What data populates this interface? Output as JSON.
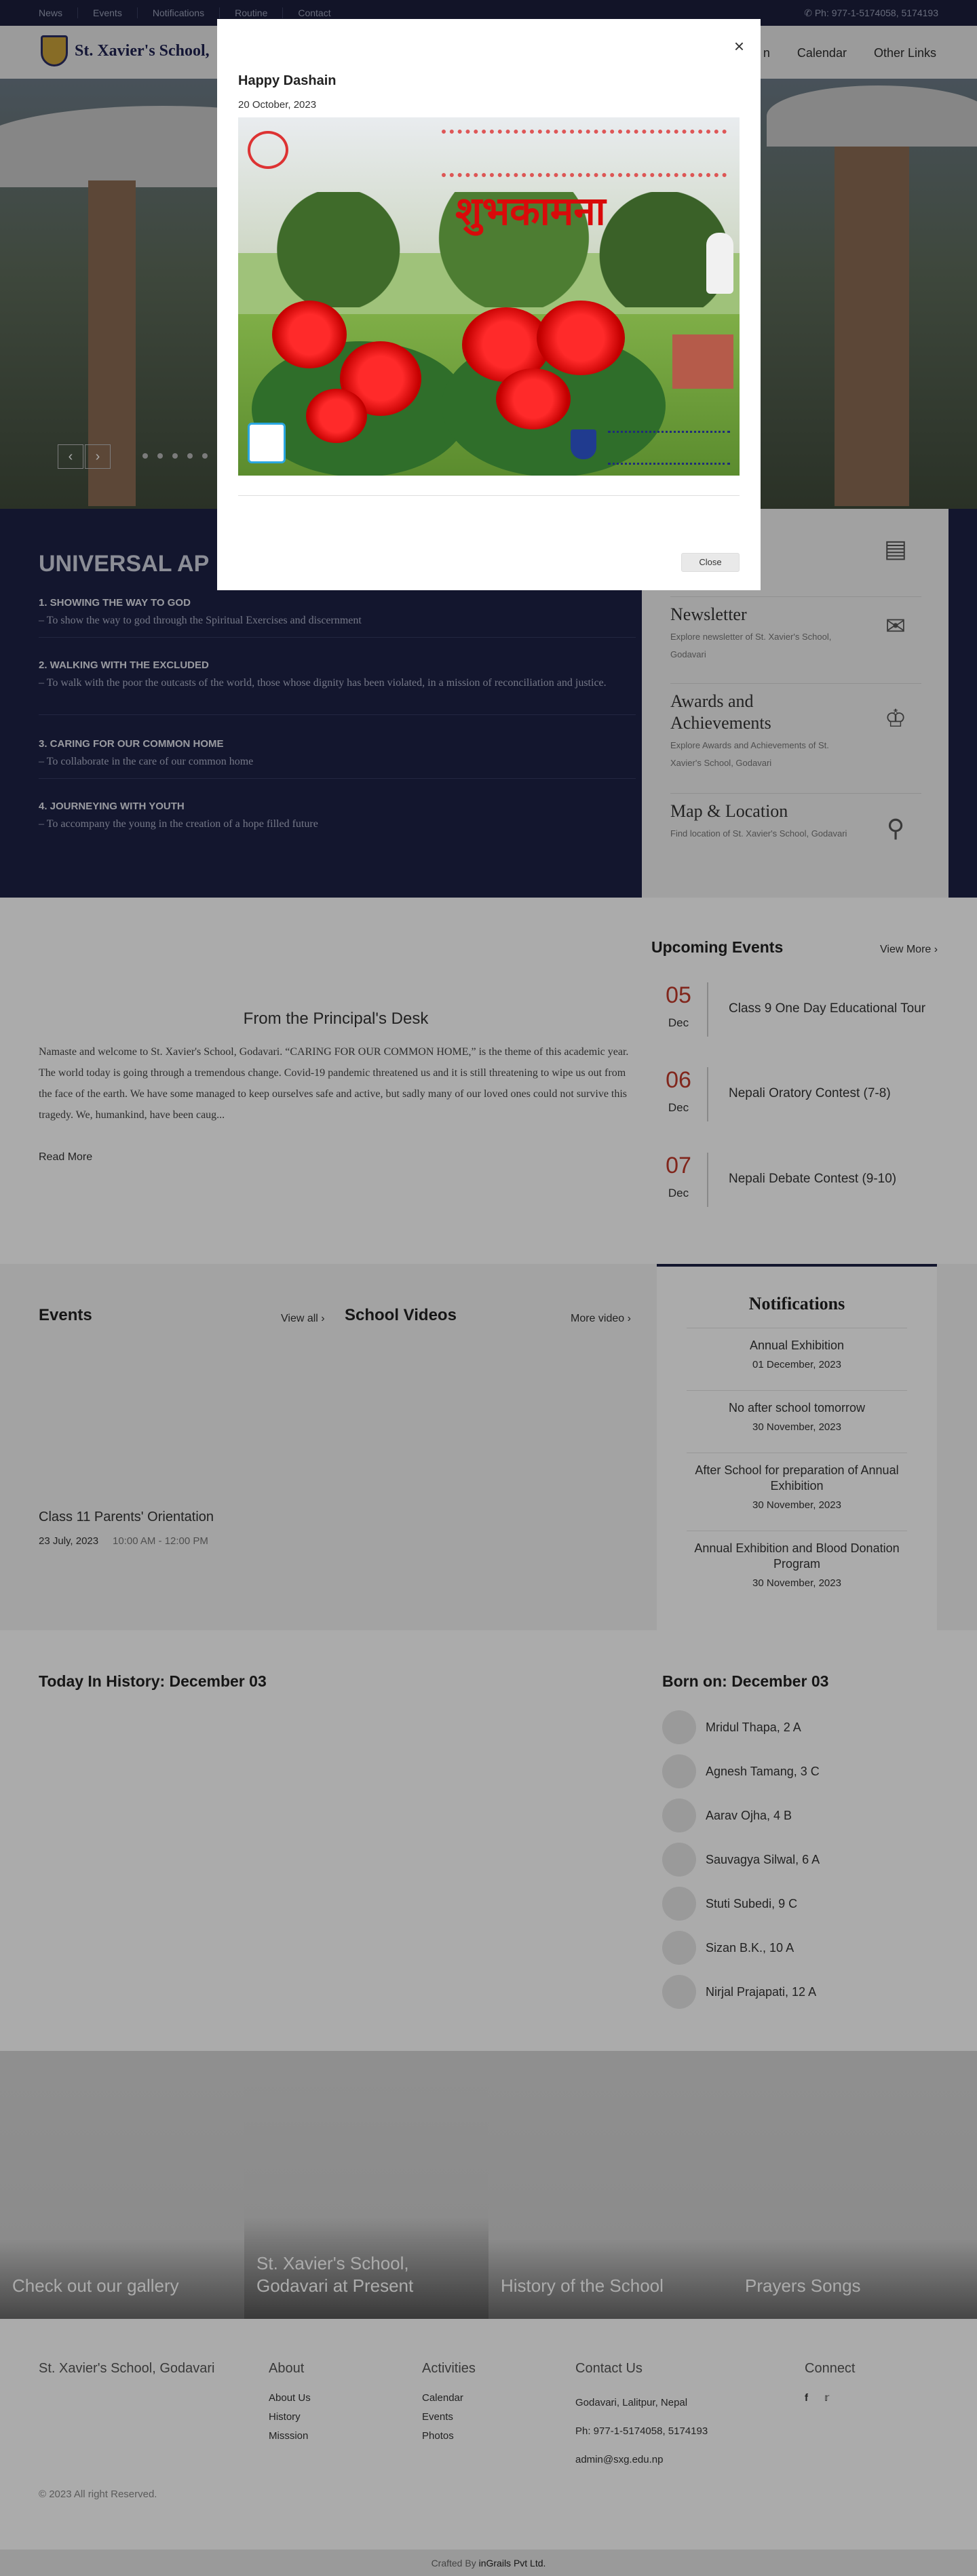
{
  "topbar": {
    "links": [
      "News",
      "Events",
      "Notifications",
      "Routine",
      "Contact"
    ],
    "phone": "Ph: 977-1-5174058, 5174193"
  },
  "header": {
    "logo_text": "St. Xavier's School,",
    "nav": [
      "n",
      "Calendar",
      "Other Links"
    ]
  },
  "hero": {
    "prev_icon": "chevron-left-icon",
    "next_icon": "chevron-right-icon",
    "dot_count": 6
  },
  "apostolic": {
    "title": "UNIVERSAL AP",
    "preferences": [
      {
        "heading": "1. SHOWING THE WAY TO GOD",
        "text": "To show the way to god through the Spiritual Exercises and discernment"
      },
      {
        "heading": "2. WALKING WITH THE EXCLUDED",
        "text": "To walk with the poor the outcasts of the world, those whose dignity has been violated, in a mission of reconciliation and justice."
      },
      {
        "heading": "3. CARING FOR OUR COMMON HOME",
        "text": "To collaborate in the care of our common home"
      },
      {
        "heading": "4. JOURNEYING WITH YOUTH",
        "text": "To accompany the young in the creation of a hope filled future"
      }
    ]
  },
  "side_panel": [
    {
      "title": "",
      "desc": "",
      "icon": "book-icon"
    },
    {
      "title": "Newsletter",
      "desc": "Explore newsletter of St. Xavier's School, Godavari",
      "icon": "envelope-icon"
    },
    {
      "title": "Awards and Achievements",
      "desc": "Explore Awards and Achievements of St. Xavier's School, Godavari",
      "icon": "trophy-icon"
    },
    {
      "title": "Map & Location",
      "desc": "Find location of St. Xavier's School, Godavari",
      "icon": "map-pin-icon"
    }
  ],
  "principal": {
    "title": "From the Principal's Desk",
    "text": "Namaste and welcome to St. Xavier's School, Godavari. “CARING FOR OUR COMMON HOME,” is the theme of this academic year. The world today is going through a tremendous change. Covid-19 pandemic threatened us and it is still threatening to wipe us out from the face of the earth. We have some managed to keep ourselves safe and active, but sadly many of our loved ones could not survive this tragedy. We, humankind, have been caug...",
    "read_more": "Read More"
  },
  "upcoming": {
    "title": "Upcoming Events",
    "view_more": "View More",
    "events": [
      {
        "day": "05",
        "month": "Dec",
        "title": "Class 9 One Day Educational Tour"
      },
      {
        "day": "06",
        "month": "Dec",
        "title": "Nepali Oratory Contest (7-8)"
      },
      {
        "day": "07",
        "month": "Dec",
        "title": "Nepali Debate Contest (9-10)"
      }
    ]
  },
  "events_section": {
    "title": "Events",
    "view_all": "View all",
    "card_title": "Class 11 Parents' Orientation",
    "card_date": "23 July, 2023",
    "card_time": "10:00 AM - 12:00 PM"
  },
  "videos": {
    "title": "School Videos",
    "more": "More video"
  },
  "notifications": {
    "title": "Notifications",
    "items": [
      {
        "title": "Annual Exhibition",
        "date": "01 December, 2023"
      },
      {
        "title": "No after school tomorrow",
        "date": "30 November, 2023"
      },
      {
        "title": "After School for preparation of Annual Exhibition",
        "date": "30 November, 2023"
      },
      {
        "title": "Annual Exhibition and Blood Donation Program",
        "date": "30 November, 2023"
      }
    ]
  },
  "history": {
    "title": "Today In History: December 03"
  },
  "born": {
    "title": "Born on: December 03",
    "people": [
      "Mridul Thapa, 2 A",
      "Agnesh Tamang, 3 C",
      "Aarav Ojha, 4 B",
      "Sauvagya Silwal, 6 A",
      "Stuti Subedi, 9 C",
      "Sizan B.K., 10 A",
      "Nirjal Prajapati, 12 A"
    ]
  },
  "tiles": [
    "Check out our gallery",
    "St. Xavier's School, Godavari at Present",
    "History of the School",
    "Prayers Songs"
  ],
  "footer": {
    "brand": "St. Xavier's School, Godavari",
    "about": {
      "title": "About",
      "links": [
        "About Us",
        "History",
        "Misssion"
      ]
    },
    "activities": {
      "title": "Activities",
      "links": [
        "Calendar",
        "Events",
        "Photos"
      ]
    },
    "contact": {
      "title": "Contact Us",
      "lines": [
        "Godavari, Lalitpur, Nepal",
        "Ph: 977-1-5174058, 5174193",
        "admin@sxg.edu.np"
      ]
    },
    "connect": {
      "title": "Connect",
      "icons": [
        "facebook-icon",
        "twitter-icon"
      ]
    },
    "copyright": "© 2023 All right Reserved.",
    "credit_prefix": "Crafted By",
    "credit_name": "inGrails Pvt Ltd."
  },
  "modal": {
    "title": "Happy Dashain",
    "date": "20 October, 2023",
    "close_label": "Close",
    "close_icon": "×",
    "poster_greeting": "शुभकामना"
  }
}
